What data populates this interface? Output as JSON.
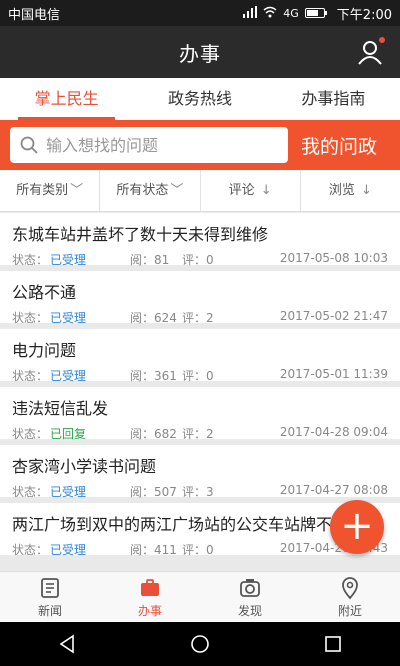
{
  "status_bar": {
    "carrier": "中国电信",
    "network": "4G",
    "time": "下午2:00"
  },
  "header": {
    "title": "办事"
  },
  "tabs": [
    {
      "label": "掌上民生",
      "active": true
    },
    {
      "label": "政务热线",
      "active": false
    },
    {
      "label": "办事指南",
      "active": false
    }
  ],
  "search": {
    "placeholder": "输入想找的问题",
    "my_question": "我的问政"
  },
  "filters": [
    {
      "label": "所有类别",
      "arrow": "﹀"
    },
    {
      "label": "所有状态",
      "arrow": "﹀"
    },
    {
      "label": "评论",
      "arrow": "↓"
    },
    {
      "label": "浏览",
      "arrow": "↓"
    }
  ],
  "items": [
    {
      "title": "东城车站井盖坏了数十天未得到维修",
      "state_label": "状态：",
      "state": "已受理",
      "reads": "阅：81",
      "comments": "评：0",
      "date": "2017-05-08 10:03"
    },
    {
      "title": "公路不通",
      "state_label": "状态：",
      "state": "已受理",
      "reads": "阅：624",
      "comments": "评：2",
      "date": "2017-05-02 21:47"
    },
    {
      "title": "电力问题",
      "state_label": "状态：",
      "state": "已受理",
      "reads": "阅：361",
      "comments": "评：0",
      "date": "2017-05-01 11:39"
    },
    {
      "title": "违法短信乱发",
      "state_label": "状态：",
      "state": "已回复",
      "reads": "阅：682",
      "comments": "评：2",
      "date": "2017-04-28 09:04"
    },
    {
      "title": "杏家湾小学读书问题",
      "state_label": "状态：",
      "state": "已受理",
      "reads": "阅：507",
      "comments": "评：3",
      "date": "2017-04-27 08:08"
    },
    {
      "title": "两江广场到双中的两江广场站的公交车站牌不清",
      "state_label": "状态：",
      "state": "已受理",
      "reads": "阅：411",
      "comments": "评：0",
      "date": "2017-04-26 17:43"
    }
  ],
  "colors": {
    "accent": "#f0542f",
    "state_accepted": "#2e87d8",
    "state_replied": "#2aa64a"
  },
  "fab": {
    "icon": "plus-icon",
    "glyph": "+"
  },
  "bottom_nav": [
    {
      "label": "新闻",
      "icon": "news-icon",
      "active": false
    },
    {
      "label": "办事",
      "icon": "briefcase-icon",
      "active": true
    },
    {
      "label": "发现",
      "icon": "camera-icon",
      "active": false
    },
    {
      "label": "附近",
      "icon": "location-pin-icon",
      "active": false
    }
  ]
}
